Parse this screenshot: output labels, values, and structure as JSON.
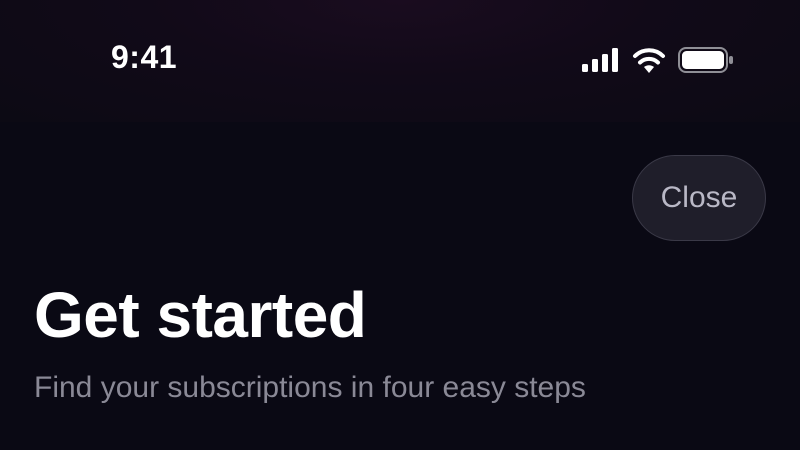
{
  "status_bar": {
    "time": "9:41",
    "icons": [
      "cellular-signal-icon",
      "wifi-icon",
      "battery-icon"
    ]
  },
  "header": {
    "close_label": "Close"
  },
  "main": {
    "title": "Get started",
    "subtitle": "Find your subscriptions in four easy steps"
  },
  "colors": {
    "background": "#0a0914",
    "status_bar_background": "#120b19",
    "close_button_background": "#1f1e2a",
    "close_button_text": "#b9b8c6",
    "title_text": "#ffffff",
    "subtitle_text": "#8a8996"
  }
}
